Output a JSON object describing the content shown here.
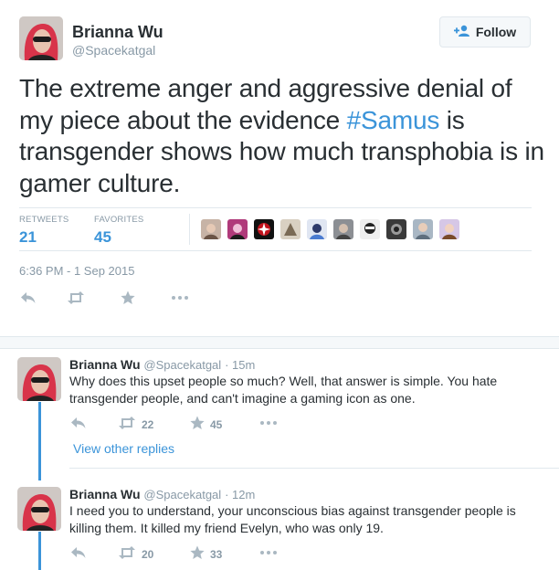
{
  "main_tweet": {
    "name": "Brianna Wu",
    "handle": "@Spacekatgal",
    "follow_label": "Follow",
    "text_before": "The extreme anger and aggressive denial of my piece about the evidence ",
    "hashtag": "#Samus",
    "text_after": " is transgender shows how much transphobia is in gamer culture.",
    "retweets_label": "RETWEETS",
    "retweets": "21",
    "favorites_label": "FAVORITES",
    "favorites": "45",
    "timestamp": "6:36 PM - 1 Sep 2015"
  },
  "replies": [
    {
      "name": "Brianna Wu",
      "handle": "@Spacekatgal",
      "time": "· 15m",
      "text": "Why does this upset people so much? Well, that answer is simple. You hate transgender people, and can't imagine a gaming icon as one.",
      "retweets": "22",
      "favorites": "45"
    },
    {
      "name": "Brianna Wu",
      "handle": "@Spacekatgal",
      "time": "· 12m",
      "text": "I need you to understand, your unconscious bias against transgender people is killing them. It killed my friend Evelyn, who was only 19.",
      "retweets": "20",
      "favorites": "33"
    }
  ],
  "view_other_replies": "View other replies",
  "colors": {
    "accent": "#3b94d9",
    "muted": "#8899a6",
    "icon": "#aab8c2",
    "border": "#e1e8ed"
  }
}
